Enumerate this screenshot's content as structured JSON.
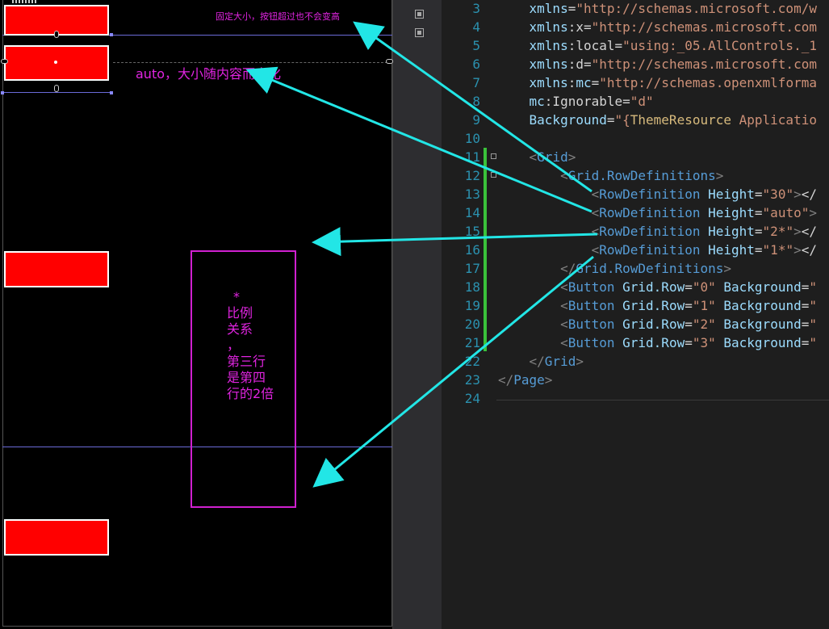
{
  "designer": {
    "annotations": {
      "fixed": "固定大小，按钮超过也不会变高",
      "auto": "auto，大小随内容而变化",
      "star_lines": [
        "*",
        "比例",
        "关系",
        "，",
        "第三行",
        "是第四",
        "行的2倍"
      ]
    }
  },
  "code": {
    "lines": [
      {
        "num": "3",
        "text": "    xmlns=\"http://schemas.microsoft.com/w"
      },
      {
        "num": "4",
        "text": "    xmlns:x=\"http://schemas.microsoft.com"
      },
      {
        "num": "5",
        "text": "    xmlns:local=\"using:_05.AllControls._1"
      },
      {
        "num": "6",
        "text": "    xmlns:d=\"http://schemas.microsoft.com"
      },
      {
        "num": "7",
        "text": "    xmlns:mc=\"http://schemas.openxmlforma"
      },
      {
        "num": "8",
        "text": "    mc:Ignorable=\"d\""
      },
      {
        "num": "9",
        "text": "    Background=\"{ThemeResource Applicatio"
      },
      {
        "num": "10",
        "text": ""
      },
      {
        "num": "11",
        "text": "    <Grid>"
      },
      {
        "num": "12",
        "text": "        <Grid.RowDefinitions>"
      },
      {
        "num": "13",
        "text": "            <RowDefinition Height=\"30\"></"
      },
      {
        "num": "14",
        "text": "            <RowDefinition Height=\"auto\">"
      },
      {
        "num": "15",
        "text": "            <RowDefinition Height=\"2*\"></"
      },
      {
        "num": "16",
        "text": "            <RowDefinition Height=\"1*\"></"
      },
      {
        "num": "17",
        "text": "        </Grid.RowDefinitions>"
      },
      {
        "num": "18",
        "text": "        <Button Grid.Row=\"0\" Background=\""
      },
      {
        "num": "19",
        "text": "        <Button Grid.Row=\"1\" Background=\""
      },
      {
        "num": "20",
        "text": "        <Button Grid.Row=\"2\" Background=\""
      },
      {
        "num": "21",
        "text": "        <Button Grid.Row=\"3\" Background=\""
      },
      {
        "num": "22",
        "text": "    </Grid>"
      },
      {
        "num": "23",
        "text": "</Page>"
      },
      {
        "num": "24",
        "text": ""
      }
    ]
  },
  "colors": {
    "button_fill": "#ff0000",
    "annotation": "#e024e0",
    "arrow": "#22e6e6",
    "line_number": "#2b91af",
    "change_bar": "#3ac23a"
  }
}
